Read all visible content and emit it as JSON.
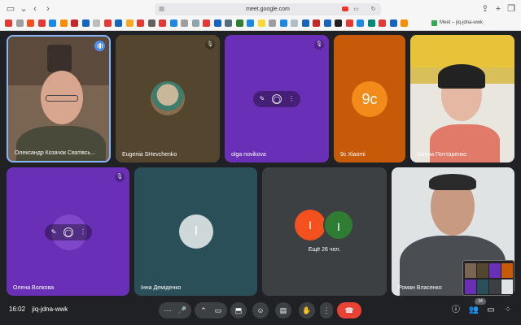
{
  "browser": {
    "url": "meet.google.com",
    "tab_title": "Meet – jiq-jdna-wwk",
    "bookmark_colors": [
      "#e53935",
      "#9e9e9e",
      "#f4511e",
      "#e53935",
      "#1e88e5",
      "#fb8c00",
      "#c62828",
      "#1565c0",
      "#bdbdbd",
      "#e53935",
      "#1565c0",
      "#f9a825",
      "#e53935",
      "#616161",
      "#e53935",
      "#1e88e5",
      "#9e9e9e",
      "#90a4ae",
      "#e53935",
      "#1565c0",
      "#546e7a",
      "#2e7d32",
      "#1e88e5",
      "#fdd835",
      "#9e9e9e",
      "#1e88e5",
      "#b0bec5",
      "#1565c0",
      "#c62828",
      "#1565c0",
      "#212121",
      "#e53935",
      "#1e88e5",
      "#00897b",
      "#e53935",
      "#1565c0",
      "#fb8c00"
    ]
  },
  "tiles": [
    {
      "name": "Олександр Козачок Сватівсь...",
      "bg": "#6b5a4a",
      "status": "speaking"
    },
    {
      "name": "Eugenia SHevchenko",
      "bg": "#54452f",
      "status": "muted"
    },
    {
      "name": "olga novikova",
      "bg": "#6a2fb7",
      "status": "muted"
    },
    {
      "name": "9c Xiaomi",
      "bg": "#c75a09",
      "status": "none",
      "avatar_text": "9c"
    },
    {
      "name": "Олена Почтаренко",
      "bg": "#d9b94a",
      "status": "none"
    },
    {
      "name": "Олена Волкова",
      "bg": "#6a2fb7",
      "status": "muted"
    },
    {
      "name": "Інна Деміденко",
      "bg": "#2b4f59",
      "status": "none",
      "avatar_text": "І"
    },
    {
      "name": "",
      "bg": "#3c4043",
      "status": "none",
      "avatars": [
        "І",
        "І"
      ],
      "more": "Ещё 26 чел."
    },
    {
      "name": "Роман Власенко",
      "bg": "#dfe3e3",
      "status": "none"
    }
  ],
  "bottom_bar": {
    "time": "16:02",
    "meeting_code": "jiq-jdna-wwk",
    "participant_count": "34",
    "icons": [
      "more-icon",
      "mic-icon",
      "mic-options-icon",
      "camera-icon",
      "present-icon",
      "emoji-icon",
      "captions-icon",
      "raise-hand-icon",
      "more-options-icon",
      "end-call-icon",
      "info-icon",
      "people-icon",
      "chat-icon",
      "activities-icon"
    ]
  }
}
